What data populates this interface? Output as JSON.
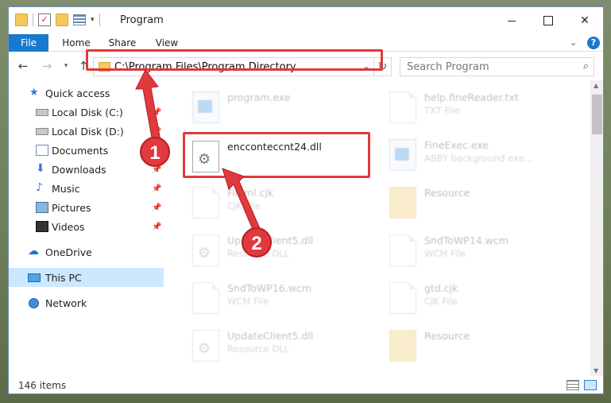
{
  "window": {
    "title": "Program"
  },
  "ribbon": {
    "tabs": [
      "File",
      "Home",
      "Share",
      "View"
    ]
  },
  "address_bar": {
    "path": "C:\\Program Files\\Program Directory"
  },
  "search": {
    "placeholder": "Search Program"
  },
  "sidebar": {
    "items": [
      {
        "label": "Quick access",
        "icon": "star-icon"
      },
      {
        "label": "Local Disk (C:)",
        "icon": "disk-icon",
        "pinned": true
      },
      {
        "label": "Local Disk (D:)",
        "icon": "disk-icon",
        "pinned": true
      },
      {
        "label": "Documents",
        "icon": "documents-icon",
        "pinned": true
      },
      {
        "label": "Downloads",
        "icon": "download-icon",
        "pinned": true
      },
      {
        "label": "Music",
        "icon": "music-icon",
        "pinned": true
      },
      {
        "label": "Pictures",
        "icon": "pictures-icon",
        "pinned": true
      },
      {
        "label": "Videos",
        "icon": "videos-icon",
        "pinned": true
      },
      {
        "label": "OneDrive",
        "icon": "onedrive-icon"
      },
      {
        "label": "This PC",
        "icon": "pc-icon",
        "selected": true
      },
      {
        "label": "Network",
        "icon": "network-icon"
      }
    ]
  },
  "files": [
    {
      "name": "program.exe",
      "type": "",
      "icon": "exe-icon",
      "faded": true
    },
    {
      "name": "help.fineReader.txt",
      "type": "TXT File",
      "icon": "document-icon",
      "faded": true
    },
    {
      "name": "encconteccnt24.dll",
      "type": "",
      "icon": "dll-icon",
      "faded": false,
      "highlighted": true
    },
    {
      "name": "FineExec.exe",
      "type": "ABBY background exe...",
      "icon": "exe-icon",
      "faded": true
    },
    {
      "name": "Fileml.cjk",
      "type": "CJK File",
      "icon": "document-icon",
      "faded": true
    },
    {
      "name": "Resource",
      "type": "",
      "icon": "folder-icon",
      "faded": true
    },
    {
      "name": "UpdateClient5.dll",
      "type": "Resource DLL",
      "icon": "dll-icon",
      "faded": true
    },
    {
      "name": "SndToWP14.wcm",
      "type": "WCM File",
      "icon": "document-icon",
      "faded": true
    },
    {
      "name": "SndToWP16.wcm",
      "type": "WCM File",
      "icon": "document-icon",
      "faded": true
    },
    {
      "name": "gtd.cjk",
      "type": "CJK File",
      "icon": "document-icon",
      "faded": true
    },
    {
      "name": "UpdateClient5.dll",
      "type": "Resource DLL",
      "icon": "dll-icon",
      "faded": true
    },
    {
      "name": "Resource",
      "type": "",
      "icon": "folder-icon",
      "faded": true
    }
  ],
  "status": {
    "item_count": "146 items"
  },
  "callouts": {
    "step1": "1",
    "step2": "2"
  },
  "colors": {
    "accent": "#1979ca",
    "highlight": "#e0393e",
    "selection": "#cce8ff"
  }
}
